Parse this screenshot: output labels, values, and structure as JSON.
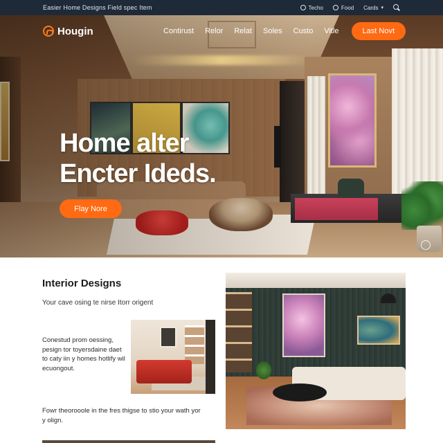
{
  "topbar": {
    "tagline": "Easier Home Designs Field spec Item",
    "items": [
      {
        "label": "Techo",
        "icon": "compass-icon"
      },
      {
        "label": "Food",
        "icon": "location-icon"
      },
      {
        "label": "Cards",
        "icon": "chevron-down-icon"
      }
    ],
    "search_icon": "search-icon"
  },
  "header": {
    "logo": "Hougin",
    "nav": [
      "Contirust",
      "Relor",
      "Relat",
      "Soles",
      "Custo",
      "Vitle"
    ],
    "cta": "Last Novt"
  },
  "hero": {
    "title_line1": "Home alter",
    "title_line2": "Encter Ideds.",
    "button": "Flay Nore"
  },
  "content": {
    "title": "Interior Designs",
    "subtitle": "Your cave osing te nirse Itorr origent",
    "body": "Conestud prom oessing, pesign tor toyersdaine daet to caty iin y homes hotlify wil ecuongout.",
    "footer": "Fowr theorooole in the fres thigse to stio your wath yor y olign."
  },
  "colors": {
    "accent": "#ff6a13",
    "topbar": "#1f2a38"
  }
}
